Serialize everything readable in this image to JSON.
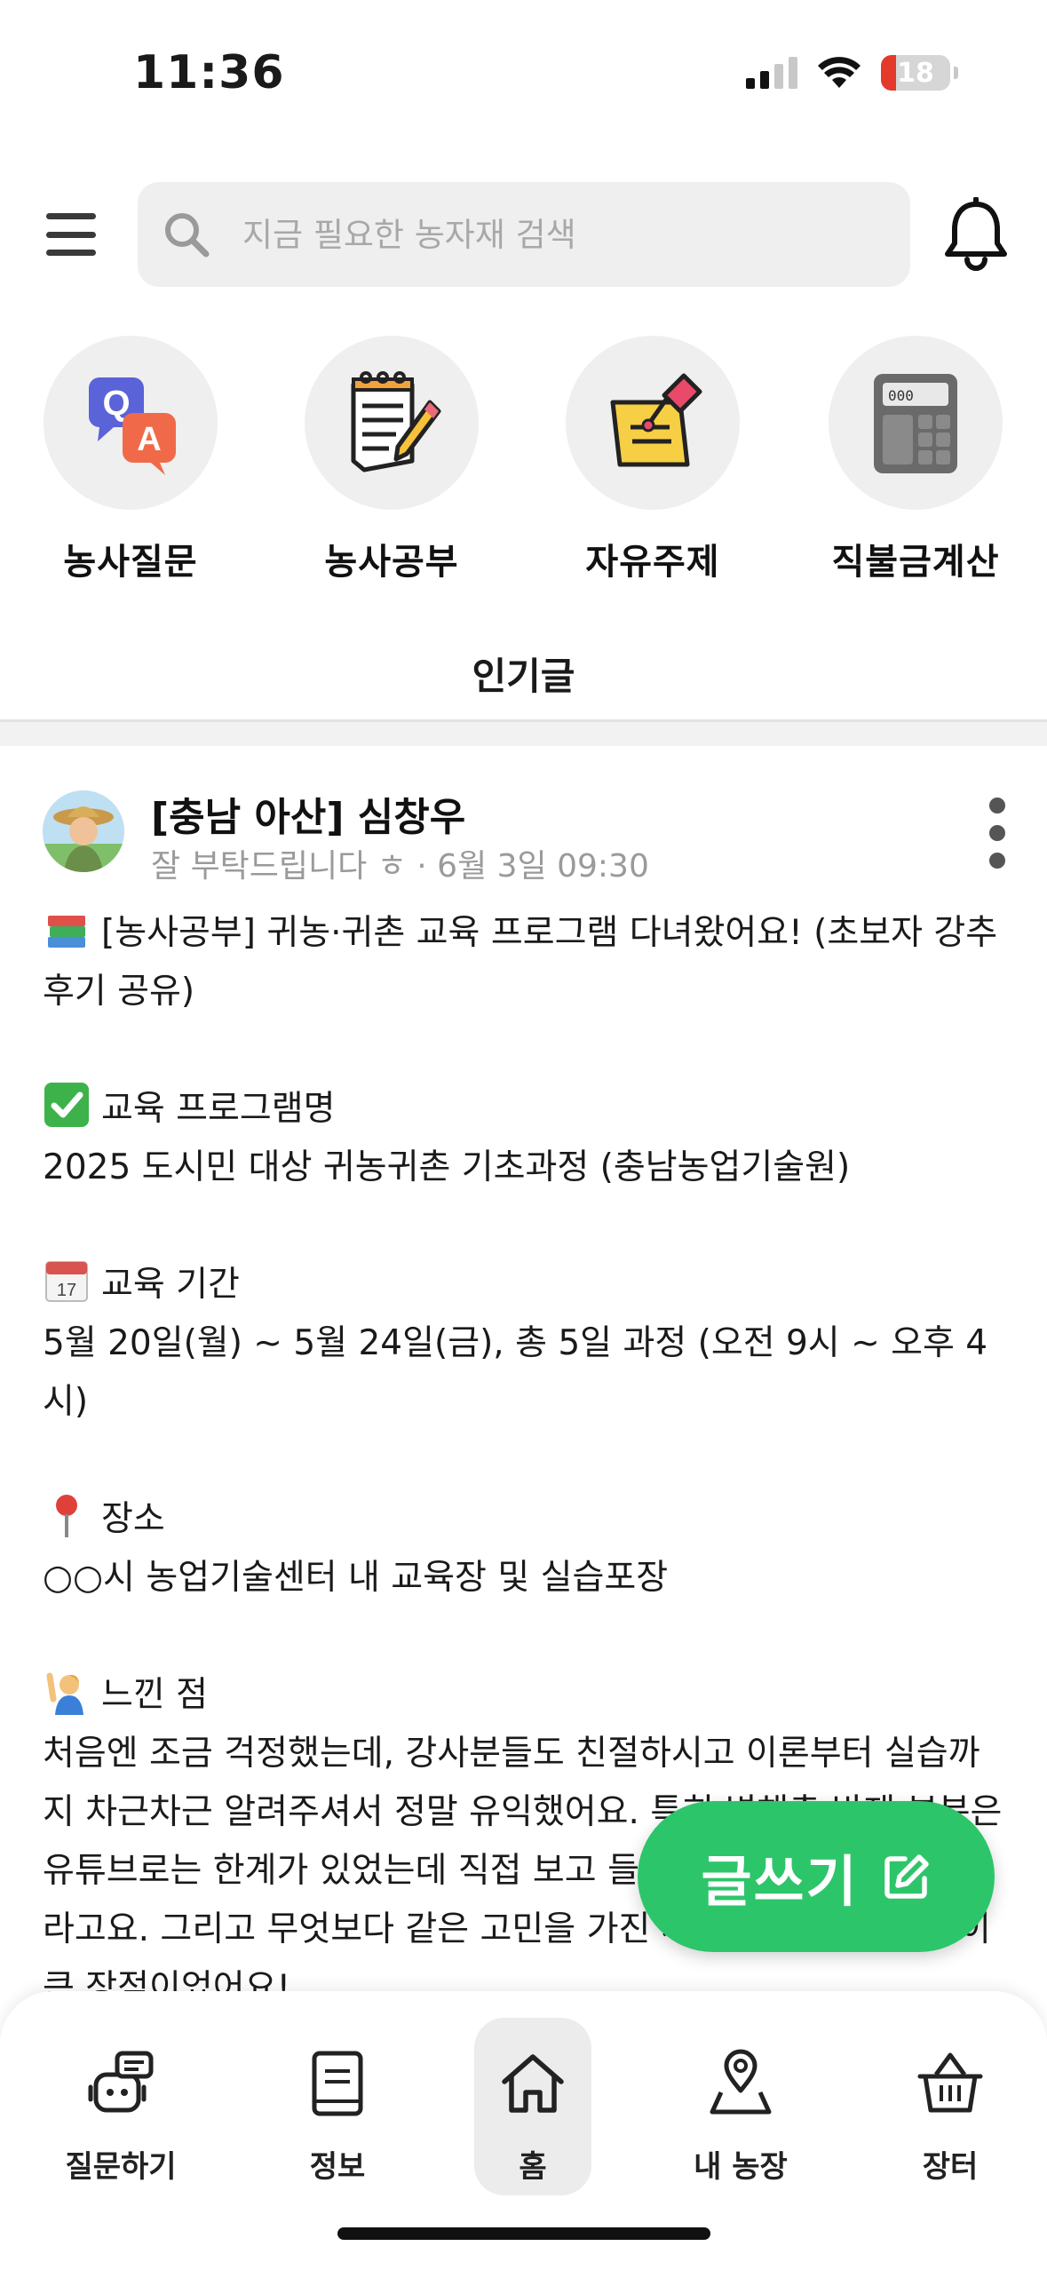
{
  "status_bar": {
    "time": "11:36",
    "battery": "18"
  },
  "header": {
    "search_placeholder": "지금 필요한 농자재 검색"
  },
  "categories": [
    {
      "label": "농사질문",
      "icon": "qa-icon"
    },
    {
      "label": "농사공부",
      "icon": "notepad-pencil-icon"
    },
    {
      "label": "자유주제",
      "icon": "pushpin-note-icon"
    },
    {
      "label": "직불금계산",
      "icon": "calculator-icon"
    }
  ],
  "section_title": "인기글",
  "post": {
    "author": "[충남 아산] 심창우",
    "meta": "잘 부탁드립니다 ㅎ · 6월 3일 09:30",
    "lines": [
      {
        "emoji": "books-emoji",
        "text": "[농사공부] 귀농·귀촌 교육 프로그램 다녀왔어요! (초보자 강추 후기 공유)"
      },
      {
        "emoji": "",
        "text": ""
      },
      {
        "emoji": "check-emoji",
        "text": "교육 프로그램명"
      },
      {
        "emoji": "",
        "text": "2025 도시민 대상 귀농귀촌 기초과정 (충남농업기술원)"
      },
      {
        "emoji": "",
        "text": ""
      },
      {
        "emoji": "calendar-emoji",
        "text": "교육 기간"
      },
      {
        "emoji": "",
        "text": "5월 20일(월) ~ 5월 24일(금), 총 5일 과정 (오전 9시 ~ 오후 4시)"
      },
      {
        "emoji": "",
        "text": ""
      },
      {
        "emoji": "pin-emoji",
        "text": "장소"
      },
      {
        "emoji": "",
        "text": "○○시 농업기술센터 내 교육장 및 실습포장"
      },
      {
        "emoji": "",
        "text": ""
      },
      {
        "emoji": "raising-hand-emoji",
        "text": "느낀 점"
      },
      {
        "emoji": "",
        "text": "처음엔 조금 걱정했는데, 강사분들도 친절하시고 이론부터 실습까지 차근차근 알려주셔서 정말 유익했어요. 특히 병해충 방제 부분은 유튜브로는 한계가 있었는데 직접 보고 들으니 이해가 확실히 되더라고요. 그리고 무엇보다 같은 고민을 가진 사람들과의 네트워킹이 큰 장점이었어요!"
      }
    ]
  },
  "write_button": {
    "label": "글쓰기"
  },
  "bottom_nav": [
    {
      "label": "질문하기",
      "icon": "robot-chat-icon"
    },
    {
      "label": "정보",
      "icon": "book-icon"
    },
    {
      "label": "홈",
      "icon": "home-icon",
      "active": true
    },
    {
      "label": "내 농장",
      "icon": "map-pin-icon"
    },
    {
      "label": "장터",
      "icon": "basket-icon"
    }
  ]
}
